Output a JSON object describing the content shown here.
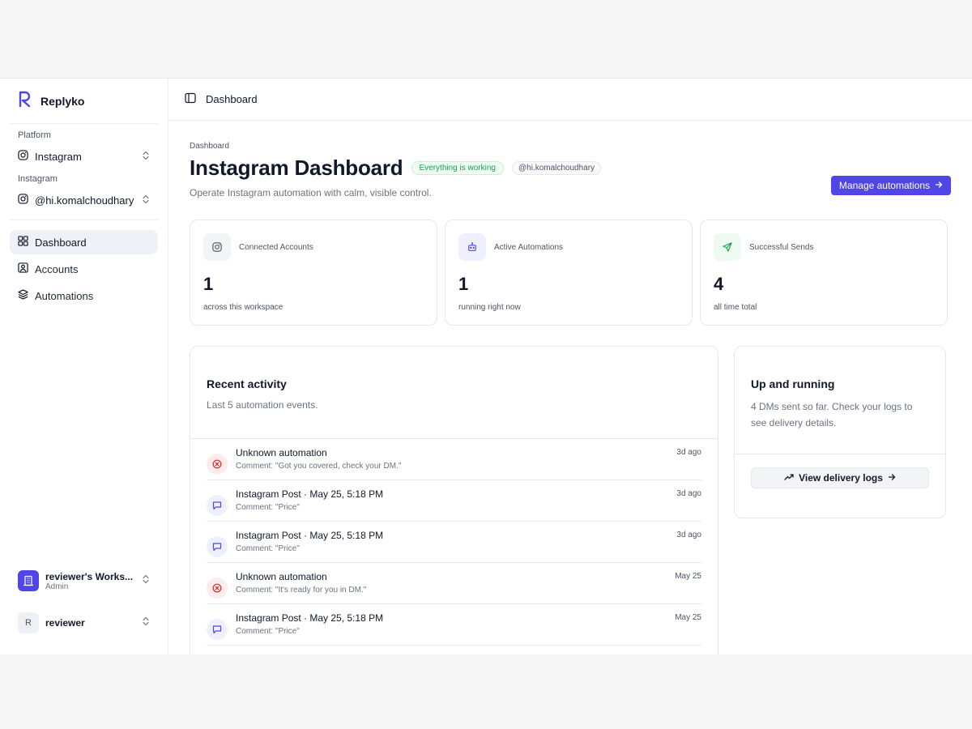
{
  "brand": {
    "name": "Replyko"
  },
  "sidebar": {
    "platform_label": "Platform",
    "platform_value": "Instagram",
    "account_label": "Instagram",
    "account_value": "@hi.komalchoudhary",
    "nav": [
      {
        "label": "Dashboard",
        "icon": "grid-icon",
        "active": true
      },
      {
        "label": "Accounts",
        "icon": "user-square-icon",
        "active": false
      },
      {
        "label": "Automations",
        "icon": "layers-icon",
        "active": false
      }
    ],
    "workspace": {
      "title": "reviewer's Works...",
      "role": "Admin"
    },
    "user": {
      "initial": "R",
      "name": "reviewer"
    }
  },
  "topbar": {
    "title": "Dashboard"
  },
  "header": {
    "breadcrumb": "Dashboard",
    "title": "Instagram Dashboard",
    "status_badge": "Everything is working",
    "handle_badge": "@hi.komalchoudhary",
    "subtitle": "Operate Instagram automation with calm, visible control.",
    "cta_label": "Manage automations"
  },
  "stats": [
    {
      "label": "Connected Accounts",
      "value": "1",
      "note": "across this workspace",
      "icon": "instagram-icon",
      "tint": "#f3f4f6",
      "color": "#4b5563"
    },
    {
      "label": "Active Automations",
      "value": "1",
      "note": "running right now",
      "icon": "bot-icon",
      "tint": "#eef0fe",
      "color": "#4f46e5"
    },
    {
      "label": "Successful Sends",
      "value": "4",
      "note": "all time total",
      "icon": "send-icon",
      "tint": "#eefaf2",
      "color": "#16a34a"
    }
  ],
  "activity": {
    "title": "Recent activity",
    "subtitle": "Last 5 automation events.",
    "items": [
      {
        "kind": "error",
        "title": "Unknown automation",
        "comment": "Comment: \"Got you covered, check your DM.\"",
        "time": "3d ago"
      },
      {
        "kind": "message",
        "title": "Instagram Post · May 25, 5:18 PM",
        "comment": "Comment: \"Price\"",
        "time": "3d ago"
      },
      {
        "kind": "message",
        "title": "Instagram Post · May 25, 5:18 PM",
        "comment": "Comment: \"Price\"",
        "time": "3d ago"
      },
      {
        "kind": "error",
        "title": "Unknown automation",
        "comment": "Comment: \"It's ready for you in DM.\"",
        "time": "May 25"
      },
      {
        "kind": "message",
        "title": "Instagram Post · May 25, 5:18 PM",
        "comment": "Comment: \"Price\"",
        "time": "May 25"
      }
    ]
  },
  "status_card": {
    "title": "Up and running",
    "text": "4 DMs sent so far. Check your logs to see delivery details.",
    "button_label": "View delivery logs"
  },
  "colors": {
    "accent": "#4f46e5",
    "success": "#16a34a",
    "error": "#dc2626",
    "error_bg": "#fdecec",
    "message_bg": "#eef0fe"
  }
}
